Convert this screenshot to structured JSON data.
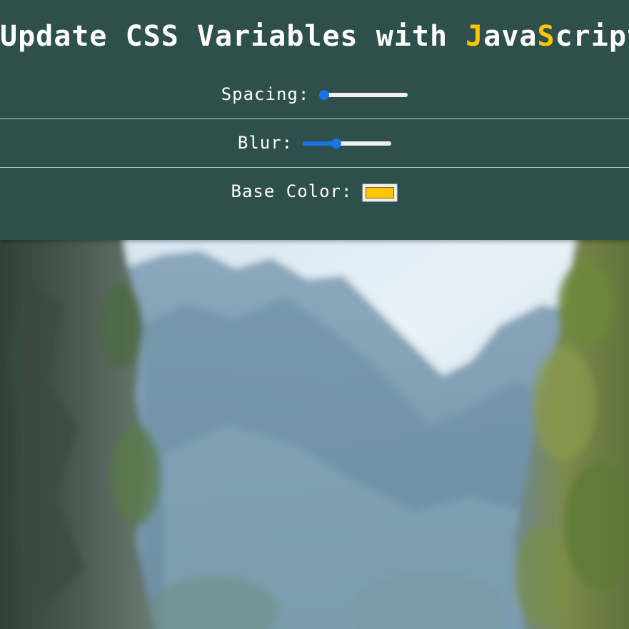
{
  "header": {
    "title_prefix": "Update CSS Variables with ",
    "title_highlight_1": "J",
    "title_mid_1": "ava",
    "title_highlight_2": "S",
    "title_suffix": "cript"
  },
  "controls": {
    "spacing": {
      "label": "Spacing:",
      "value_fraction": 0.0
    },
    "blur": {
      "label": "Blur:",
      "value_fraction": 0.36
    },
    "base_color": {
      "label": "Base Color:",
      "value": "#ffc600"
    }
  },
  "colors": {
    "background": "#2e504c",
    "text": "#ffffff",
    "accent": "#ffc600",
    "slider": "#1a73e8"
  },
  "image": {
    "description_icon": "landscape-image-icon"
  }
}
